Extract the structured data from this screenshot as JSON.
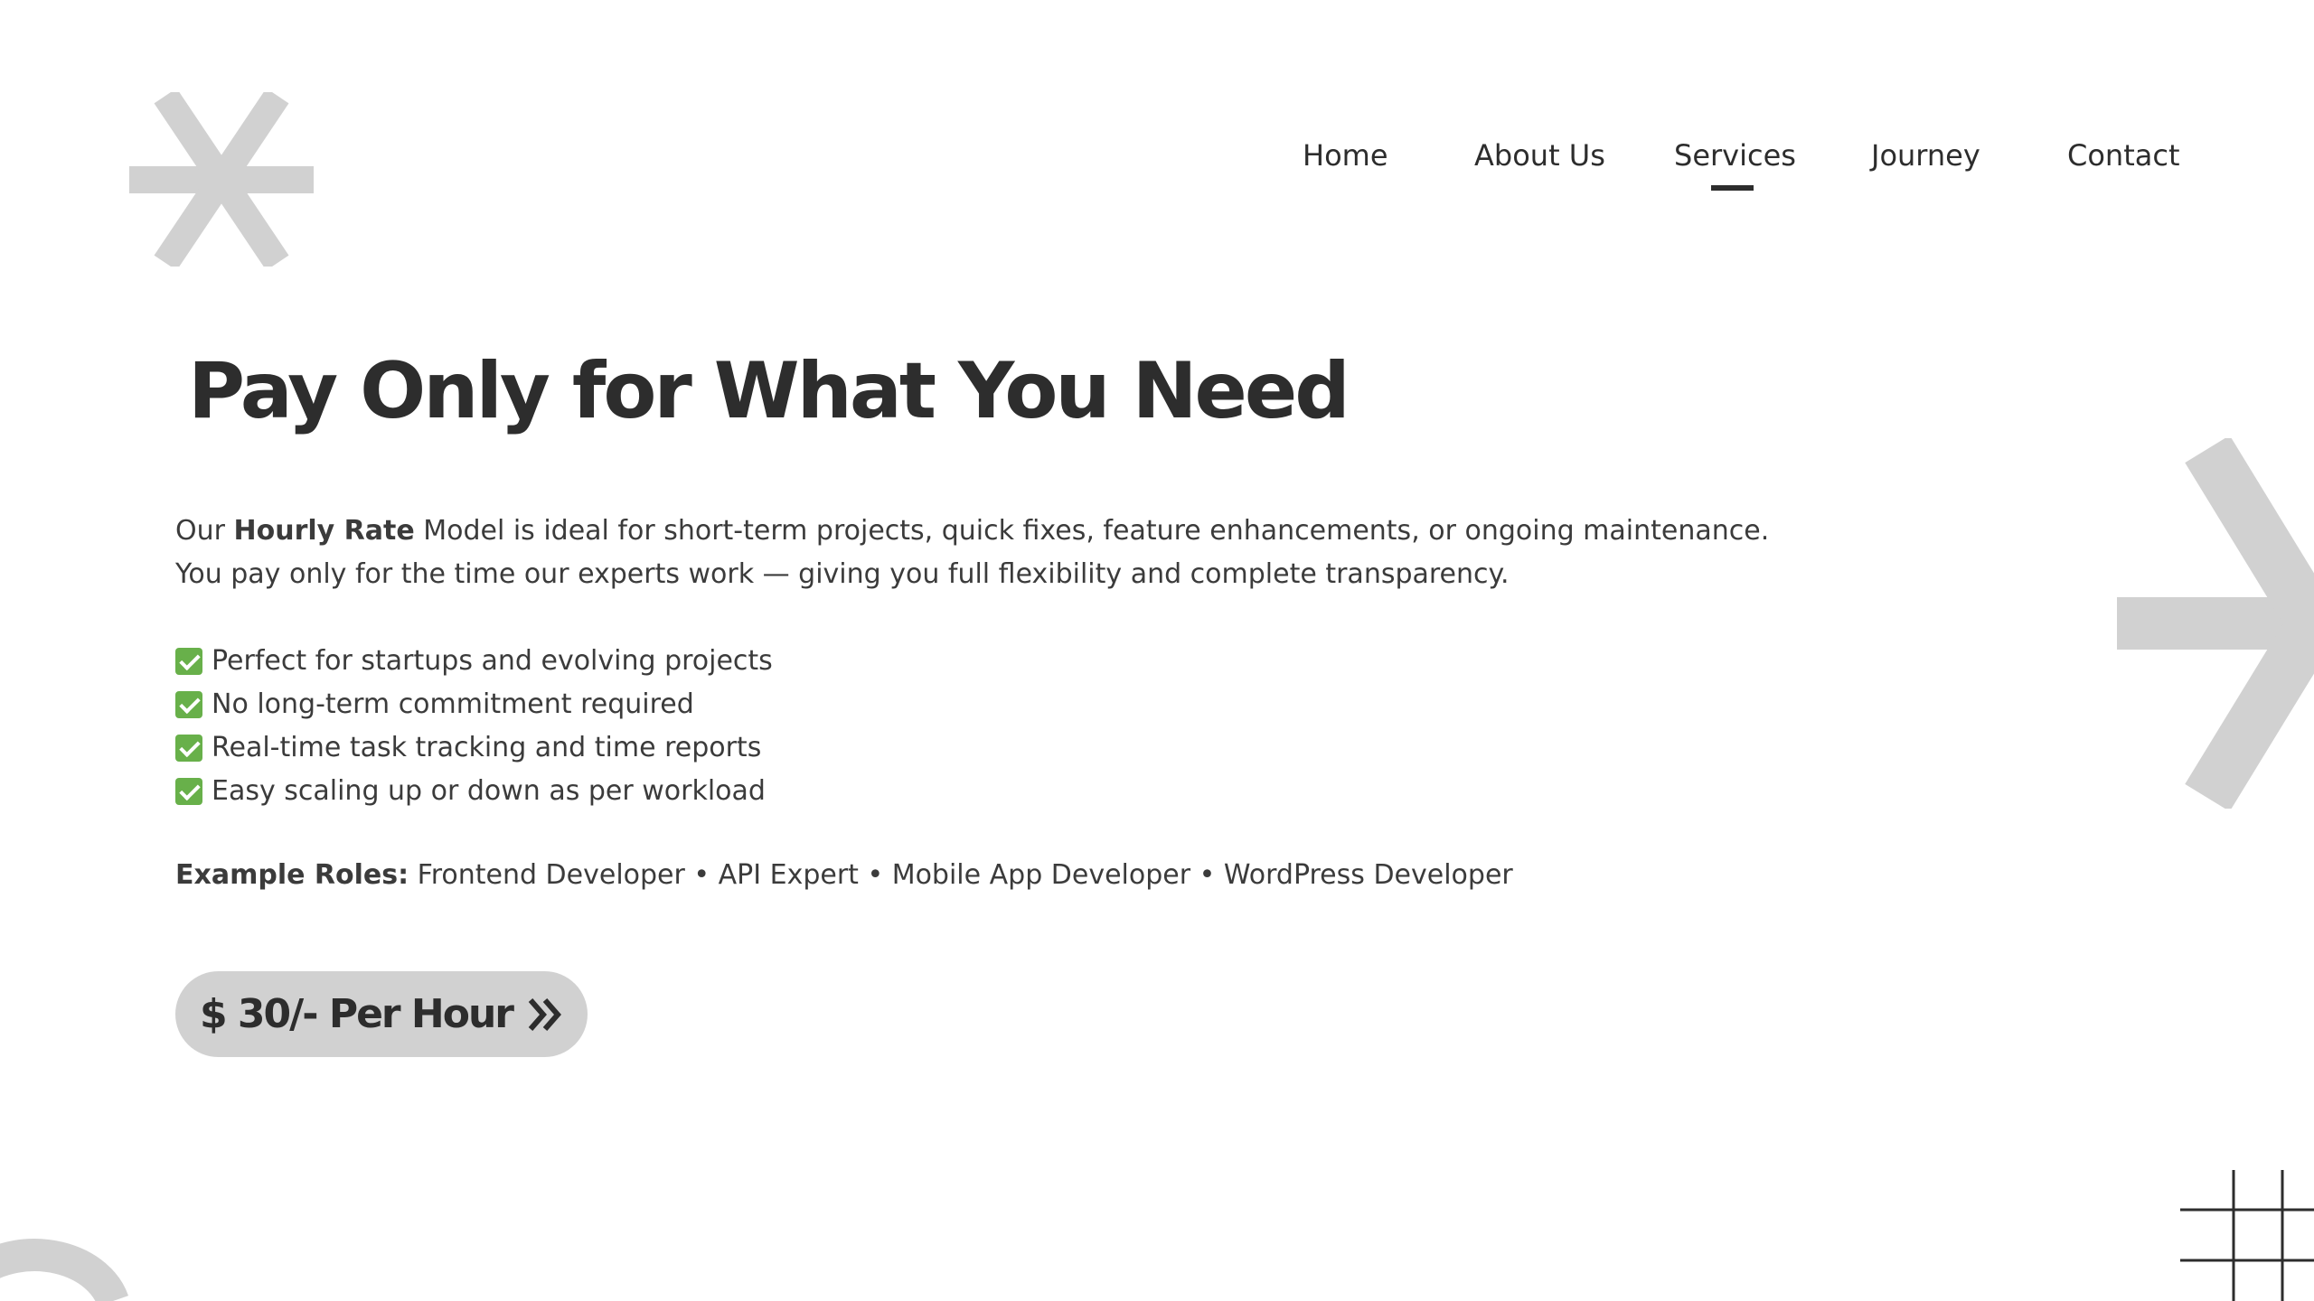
{
  "nav": {
    "items": [
      {
        "label": "Home"
      },
      {
        "label": "About Us"
      },
      {
        "label": "Services",
        "active": true
      },
      {
        "label": "Journey"
      },
      {
        "label": "Contact"
      }
    ]
  },
  "hero": {
    "title": "Pay Only for What You Need",
    "intro_prefix": "Our ",
    "intro_bold": "Hourly Rate",
    "intro_rest": " Model is ideal for short-term projects, quick fixes, feature enhancements, or ongoing maintenance.",
    "intro_line2": "You pay only for the time our experts work — giving you full flexibility and complete transparency."
  },
  "features": [
    "Perfect for startups and evolving projects",
    "No long-term commitment required",
    "Real-time task tracking and time reports",
    "Easy scaling up or down as per workload"
  ],
  "roles": {
    "label": "Example Roles:",
    "list": " Frontend Developer • API Expert • Mobile App Developer • WordPress Developer"
  },
  "cta": {
    "label": "$ 30/- Per Hour",
    "icon": "double-chevron-right-icon"
  },
  "colors": {
    "text": "#2d2d2d",
    "decor": "#d1d1d1",
    "check": "#68b04a"
  }
}
